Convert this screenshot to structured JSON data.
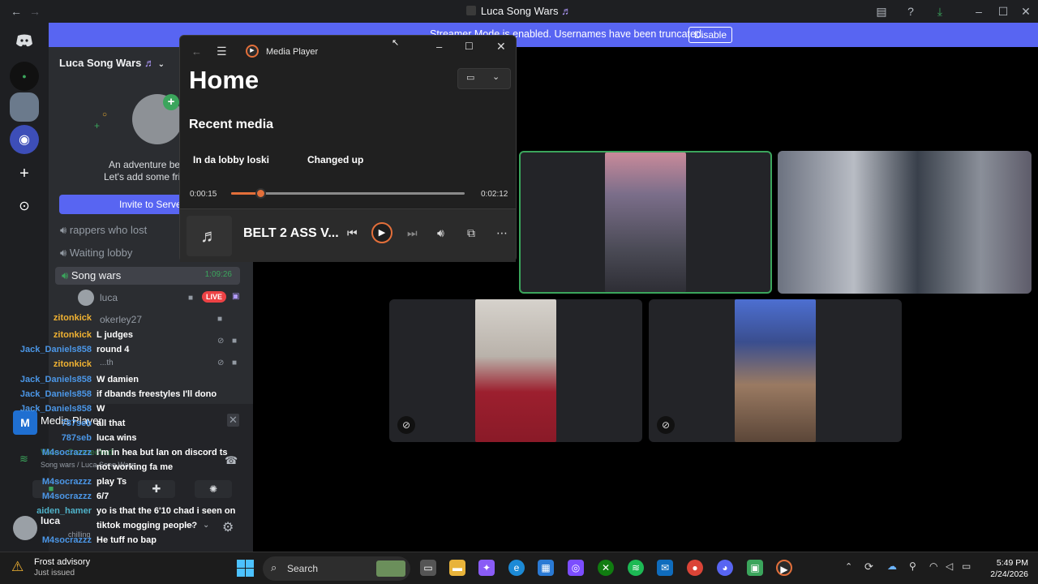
{
  "titlebar": {
    "title": "Luca Song Wars",
    "title_icon": "music-note-icon",
    "back": "←",
    "forward": "→"
  },
  "banner": {
    "text": "Streamer Mode is enabled. Usernames have been truncated.",
    "disable_label": "Disable"
  },
  "server": {
    "name": "Luca Song Wars",
    "welcome_line1": "An adventure beg",
    "welcome_line2": "Let's add some frie",
    "invite_label": "Invite to Serve"
  },
  "channels": [
    {
      "name": "rappers who lost",
      "selected": false
    },
    {
      "name": "Waiting lobby",
      "selected": false
    },
    {
      "name": "Song wars",
      "selected": true,
      "timer": "1:09:26"
    }
  ],
  "voice_users": [
    {
      "name": "luca",
      "badge": "LIVE"
    },
    {
      "name": "okerley27"
    },
    {
      "name": "...th"
    }
  ],
  "chat": [
    {
      "user": "zitonkick",
      "msg": "",
      "color": "gold"
    },
    {
      "user": "zitonkick",
      "msg": "L judges",
      "color": "gold"
    },
    {
      "user": "Jack_Daniels858",
      "msg": "round 4",
      "color": "blue"
    },
    {
      "user": "zitonkick",
      "msg": "",
      "color": "gold"
    },
    {
      "user": "Jack_Daniels858",
      "msg": "W damien",
      "color": "blue"
    },
    {
      "user": "Jack_Daniels858",
      "msg": "if dbands freestyles I'll dono",
      "color": "blue"
    },
    {
      "user": "Jack_Daniels858",
      "msg": "W",
      "color": "blue"
    },
    {
      "user": "787seb",
      "msg": "all that",
      "color": "blue"
    },
    {
      "user": "787seb",
      "msg": "luca wins",
      "color": "blue"
    },
    {
      "user": "M4socrazzz",
      "msg": "I'm in hea but lan on discord ts",
      "color": "blue"
    },
    {
      "user": "",
      "msg": "not working fa me",
      "color": "blue"
    },
    {
      "user": "M4socrazzz",
      "msg": "play Ts",
      "color": "blue"
    },
    {
      "user": "M4socrazzz",
      "msg": "6/7",
      "color": "blue"
    },
    {
      "user": "aiden_hamer",
      "msg": "yo is that the 6'10 chad i seen on",
      "color": "teal"
    },
    {
      "user": "",
      "msg": "tiktok mogging people?",
      "color": "teal"
    },
    {
      "user": "M4socrazzz",
      "msg": "He tuff no bap",
      "color": "blue"
    }
  ],
  "mini_player": {
    "title": "Media Player",
    "voice_status": "Video Connected",
    "voice_sub": "Song wars / Luca Song Wars"
  },
  "user_panel": {
    "name": "luca",
    "status": "chilling"
  },
  "media_player": {
    "window_title": "Media Player",
    "home": "Home",
    "recent": "Recent media",
    "items": [
      "In da lobby loski",
      "Changed up"
    ],
    "elapsed": "0:00:15",
    "duration": "0:02:12",
    "progress": 0.125,
    "song": "BELT 2 ASS V...",
    "accent": "#e36f3a"
  },
  "taskbar": {
    "weather_title": "Frost advisory",
    "weather_sub": "Just issued",
    "search_label": "Search",
    "time": "5:49 PM",
    "date": "2/24/2026"
  }
}
